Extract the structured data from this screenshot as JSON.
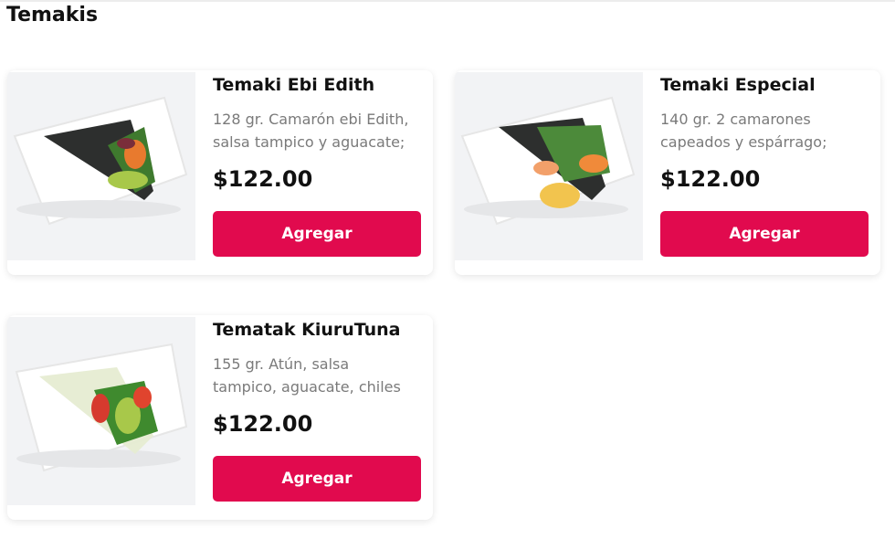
{
  "section": {
    "title": "Temakis"
  },
  "button_label": "Agregar",
  "colors": {
    "accent": "#e10a4e",
    "text": "#111111",
    "muted": "#7a7a7a"
  },
  "products": [
    {
      "name": "Temaki Ebi Edith",
      "desc_line1": "128 gr. Camarón ebi Edith,",
      "desc_line2": "salsa tampico y aguacate;",
      "price": "$122.00",
      "image_icon": "temaki-ebi-image"
    },
    {
      "name": "Temaki Especial",
      "desc_line1": "140 gr. 2 camarones",
      "desc_line2": "capeados y espárrago;",
      "price": "$122.00",
      "image_icon": "temaki-especial-image"
    },
    {
      "name": "Tematak KiuruTuna",
      "desc_line1": "155 gr. Atún, salsa",
      "desc_line2": "tampico, aguacate, chiles",
      "price": "$122.00",
      "image_icon": "temaki-tuna-image"
    }
  ]
}
